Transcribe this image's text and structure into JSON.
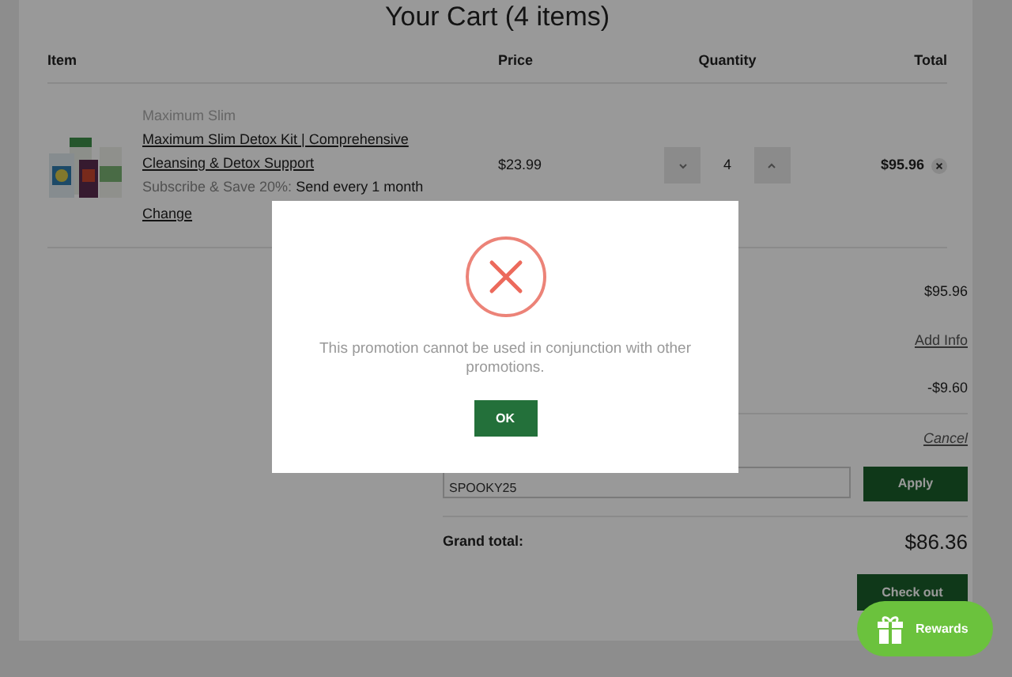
{
  "cart": {
    "title": "Your Cart (4 items)",
    "columns": [
      "Item",
      "Price",
      "Quantity",
      "Total"
    ],
    "items": [
      {
        "brand": "Maximum Slim",
        "name": "Maximum Slim Detox Kit | Comprehensive Cleansing & Detox Support",
        "subscription_label": "Subscribe & Save 20%:",
        "subscription_value": "Send every 1 month",
        "change_link": "Change",
        "price": "$23.99",
        "quantity": "4",
        "total": "$95.96"
      }
    ]
  },
  "summary": {
    "subtotal": "$95.96",
    "add_info_link": "Add Info",
    "discount": "-$9.60",
    "cancel_link": "Cancel",
    "promo_code": "SPOOKY25",
    "apply_button": "Apply",
    "grand_total_label": "Grand total:",
    "grand_total": "$86.36",
    "checkout_button": "Check out"
  },
  "dialog": {
    "message": "This promotion cannot be used in conjunction with other promotions.",
    "ok_button": "OK"
  },
  "rewards_button": "Rewards"
}
